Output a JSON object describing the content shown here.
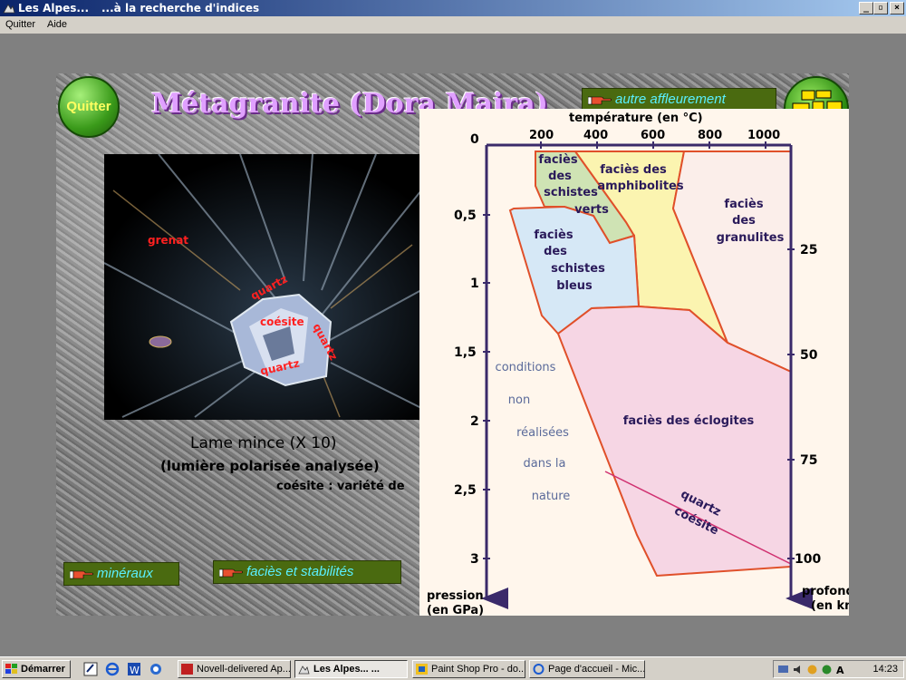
{
  "window": {
    "title_app": "Les Alpes...",
    "title_doc": "...à la recherche d'indices",
    "minimize": "_",
    "maximize": "▫",
    "close": "×"
  },
  "menu": {
    "items": [
      "Quitter",
      "Aide"
    ]
  },
  "slide": {
    "quit_button": "Quitter",
    "title": "Métagranite (Dora Maira)",
    "autre_link": "autre affleurement",
    "mineraux_link": "minéraux",
    "facies_link": "faciès et stabilités",
    "thin_section_labels": {
      "grenat": "grenat",
      "quartz1": "quartz",
      "coesite": "coésite",
      "quartz2": "quartz",
      "quartz3": "quartz"
    },
    "caption_line1": "Lame mince (X 10)",
    "caption_line2": "(lumière polarisée analysée)",
    "caption_line3": "coésite : variété de"
  },
  "diagram": {
    "x_title": "température (en °C)",
    "x_ticks": [
      "200",
      "400",
      "600",
      "800",
      "1000"
    ],
    "y_left_ticks": [
      "0",
      "0,5",
      "1",
      "1,5",
      "2",
      "2,5",
      "3"
    ],
    "y_right_ticks": [
      "25",
      "50",
      "75",
      "100"
    ],
    "y_left_title_1": "pression",
    "y_left_title_2": "(en GPa)",
    "y_right_title_1": "profond",
    "y_right_title_2": "(en km",
    "facies": {
      "schistes_verts": [
        "faciès",
        "des",
        "schistes",
        "verts"
      ],
      "amphibolites": [
        "faciès des",
        "amphibolites"
      ],
      "granulites": [
        "faciès",
        "des",
        "granulites"
      ],
      "schistes_bleus": [
        "faciès",
        "des",
        "schistes",
        "bleus"
      ],
      "eclogites": "faciès des éclogites",
      "quartz": "quartz",
      "coesite": "coésite",
      "conditions": [
        "conditions",
        "non",
        "réalisées",
        "dans la",
        "nature"
      ]
    },
    "colors": {
      "green": "#cfe3b4",
      "yellow": "#fbf4b0",
      "blue": "#d6e8f6",
      "pink": "#f6d6e4",
      "border": "#e0502a",
      "axis": "#3a2a6a"
    }
  },
  "taskbar": {
    "start": "Démarrer",
    "tasks": [
      {
        "label": "Novell-delivered Ap...",
        "active": false
      },
      {
        "label": "Les Alpes...       ...",
        "active": true
      },
      {
        "label": "Paint Shop Pro - do...",
        "active": false
      },
      {
        "label": "Page d'accueil - Mic...",
        "active": false
      }
    ],
    "clock": "14:23"
  }
}
